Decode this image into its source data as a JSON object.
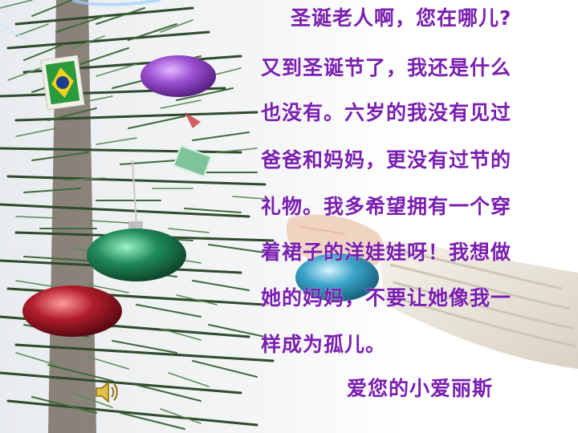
{
  "letter": {
    "greeting": "圣诞老人啊，您在哪儿?",
    "lines": [
      "又到圣诞节了，我还是什么",
      "也没有。六岁的我没有见过",
      "爸爸和妈妈，更没有过节的",
      "礼物。我多希望拥有一个穿",
      "着裙子的洋娃娃呀！我想做",
      "她的妈妈，不要让她像我一",
      "样成为孤儿。"
    ],
    "signature": "爱您的小爱丽斯"
  },
  "audio": {
    "icon": "speaker-icon"
  },
  "colors": {
    "text": "#7a1fb0",
    "tree": "#2f4a2c",
    "ornament_purple": "#9b4fd1",
    "ornament_green": "#1f8a5a",
    "ornament_red": "#b01d2a",
    "ornament_teal": "#3aa3c9"
  }
}
